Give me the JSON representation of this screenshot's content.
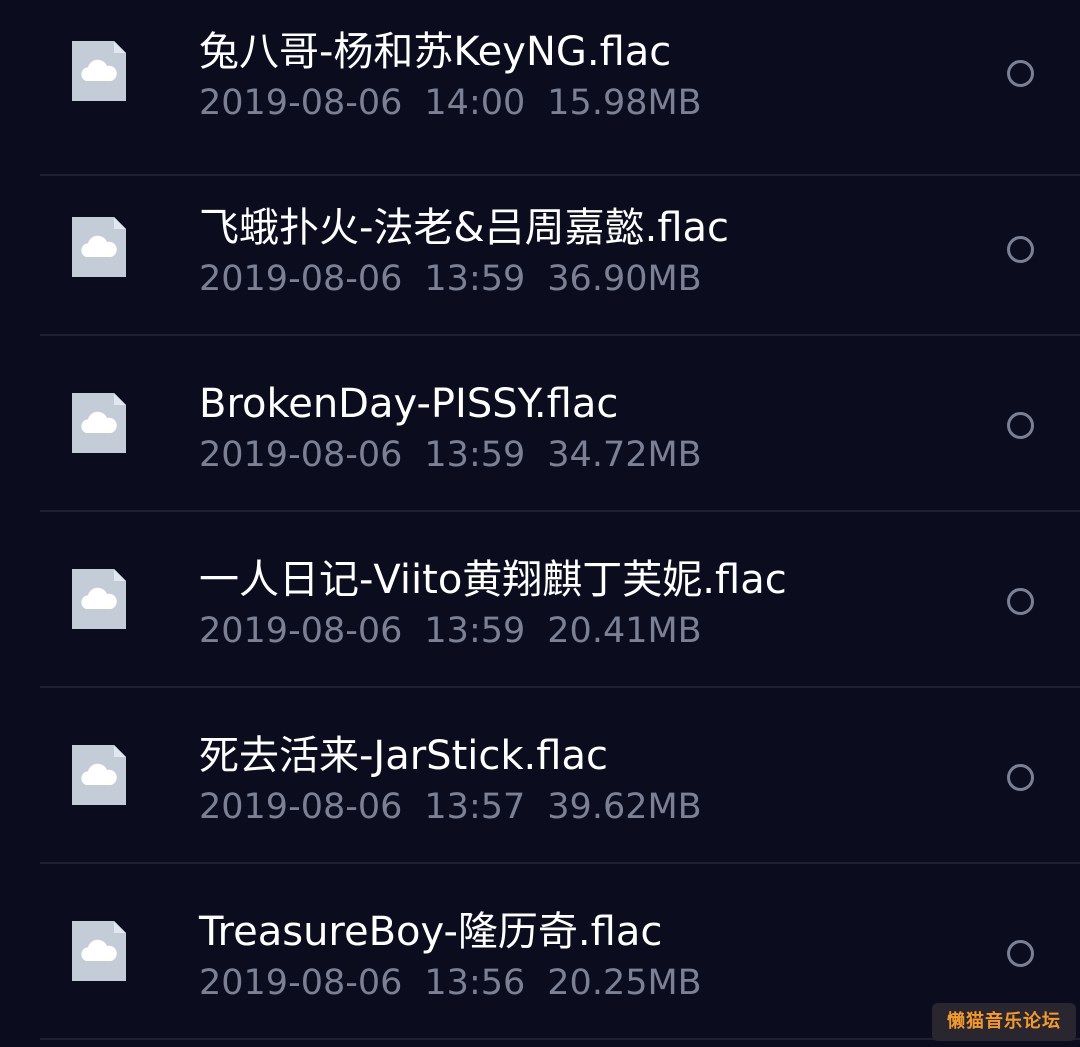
{
  "files": [
    {
      "name": "兔八哥-杨和苏KeyNG.flac",
      "date": "2019-08-06",
      "time": "14:00",
      "size": "15.98MB",
      "icon": "cloud-file-icon",
      "selected": false
    },
    {
      "name": "飞蛾扑火-法老&吕周嘉懿.flac",
      "date": "2019-08-06",
      "time": "13:59",
      "size": "36.90MB",
      "icon": "cloud-file-icon",
      "selected": false
    },
    {
      "name": "BrokenDay-PISSY.flac",
      "date": "2019-08-06",
      "time": "13:59",
      "size": "34.72MB",
      "icon": "cloud-file-icon",
      "selected": false
    },
    {
      "name": "一人日记-Viito黄翔麒丁芙妮.flac",
      "date": "2019-08-06",
      "time": "13:59",
      "size": "20.41MB",
      "icon": "cloud-file-icon",
      "selected": false
    },
    {
      "name": "死去活来-JarStick.flac",
      "date": "2019-08-06",
      "time": "13:57",
      "size": "39.62MB",
      "icon": "cloud-file-icon",
      "selected": false
    },
    {
      "name": "TreasureBoy-隆历奇.flac",
      "date": "2019-08-06",
      "time": "13:56",
      "size": "20.25MB",
      "icon": "cloud-file-icon",
      "selected": false
    }
  ],
  "watermark": {
    "text": "懒猫音乐论坛"
  },
  "colors": {
    "background": "#0b0d1e",
    "name_text": "#ffffff",
    "meta_text": "#7c8095",
    "icon": "#c4ccd8",
    "watermark_text": "#f29a2e"
  }
}
